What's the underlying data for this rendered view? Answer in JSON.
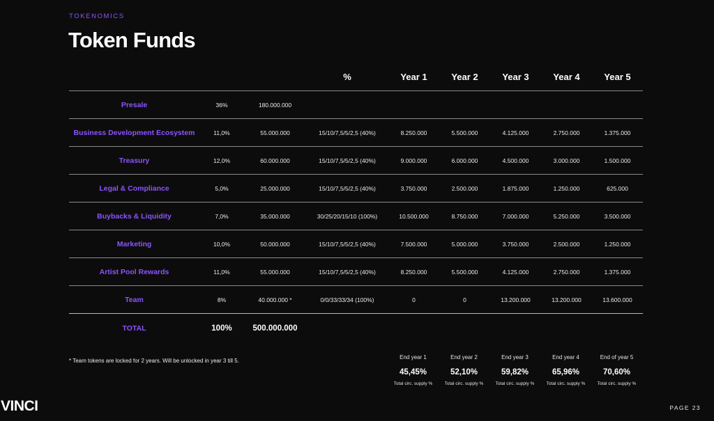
{
  "header": {
    "eyebrow": "TOKENOMICS",
    "title": "Token Funds"
  },
  "table": {
    "columns": [
      "",
      "",
      "",
      "%",
      "Year 1",
      "Year 2",
      "Year 3",
      "Year 4",
      "Year 5"
    ],
    "rows": [
      {
        "label": "Presale",
        "pct": "36%",
        "amount": "180.000.000",
        "schedule": "",
        "y1": "",
        "y2": "",
        "y3": "",
        "y4": "",
        "y5": ""
      },
      {
        "label": "Business Development Ecosystem",
        "pct": "11,0%",
        "amount": "55.000.000",
        "schedule": "15/10/7,5/5/2,5 (40%)",
        "y1": "8.250.000",
        "y2": "5.500.000",
        "y3": "4.125.000",
        "y4": "2.750.000",
        "y5": "1.375.000"
      },
      {
        "label": "Treasury",
        "pct": "12,0%",
        "amount": "60.000.000",
        "schedule": "15/10/7,5/5/2,5 (40%)",
        "y1": "9.000.000",
        "y2": "6.000.000",
        "y3": "4.500.000",
        "y4": "3.000.000",
        "y5": "1.500.000"
      },
      {
        "label": "Legal & Compliance",
        "pct": "5,0%",
        "amount": "25.000.000",
        "schedule": "15/10/7,5/5/2,5 (40%)",
        "y1": "3.750.000",
        "y2": "2.500.000",
        "y3": "1.875.000",
        "y4": "1.250.000",
        "y5": "625.000"
      },
      {
        "label": "Buybacks & Liquidity",
        "pct": "7,0%",
        "amount": "35.000.000",
        "schedule": "30/25/20/15/10 (100%)",
        "y1": "10.500.000",
        "y2": "8.750.000",
        "y3": "7.000.000",
        "y4": "5.250.000",
        "y5": "3.500.000"
      },
      {
        "label": "Marketing",
        "pct": "10,0%",
        "amount": "50.000.000",
        "schedule": "15/10/7,5/5/2,5 (40%)",
        "y1": "7.500.000",
        "y2": "5.000.000",
        "y3": "3.750.000",
        "y4": "2.500.000",
        "y5": "1.250.000"
      },
      {
        "label": "Artist Pool Rewards",
        "pct": "11,0%",
        "amount": "55.000.000",
        "schedule": "15/10/7,5/5/2,5 (40%)",
        "y1": "8.250.000",
        "y2": "5.500.000",
        "y3": "4.125.000",
        "y4": "2.750.000",
        "y5": "1.375.000"
      },
      {
        "label": "Team",
        "pct": "8%",
        "amount": "40.000.000 *",
        "schedule": "0/0/33/33/34 (100%)",
        "y1": "0",
        "y2": "0",
        "y3": "13.200.000",
        "y4": "13.200.000",
        "y5": "13.600.000"
      }
    ],
    "total": {
      "label": "TOTAL",
      "pct": "100%",
      "amount": "500.000.000"
    }
  },
  "footnote": "* Team tokens are locked for 2 years. Will be unlocked in year 3 till 5.",
  "supply": [
    {
      "label": "End year 1",
      "value": "45,45%",
      "caption": "Total circ. supply %"
    },
    {
      "label": "End year 2",
      "value": "52,10%",
      "caption": "Total circ. supply %"
    },
    {
      "label": "End year 3",
      "value": "59,82%",
      "caption": "Total circ. supply %"
    },
    {
      "label": "End year 4",
      "value": "65,96%",
      "caption": "Total circ. supply %"
    },
    {
      "label": "End of year 5",
      "value": "70,60%",
      "caption": "Total circ. supply %"
    }
  ],
  "footer": {
    "logo": "VINCI",
    "page": "PAGE 23"
  },
  "colors": {
    "background": "#0d0c0d",
    "accent": "#8a54ff",
    "text": "#ffffff",
    "rule": "#8c8c8c"
  }
}
